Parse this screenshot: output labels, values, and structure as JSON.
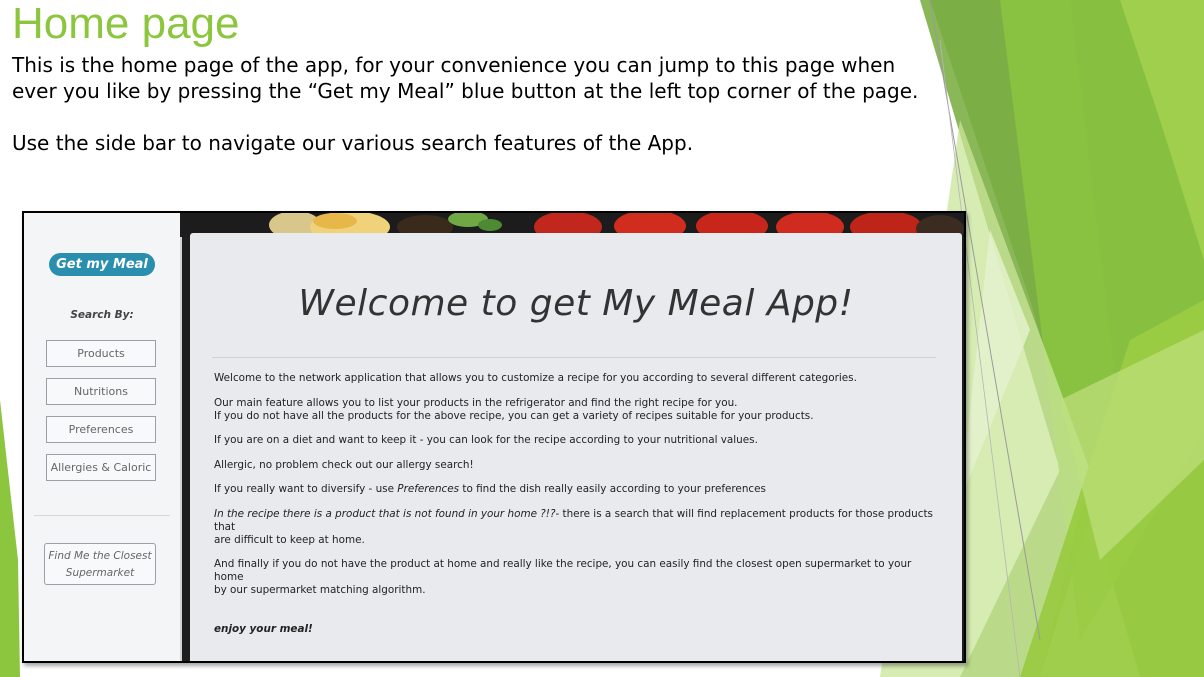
{
  "slide": {
    "title": "Home page",
    "intro_line1": "This is the home page of the app, for your convenience you can jump to this page when",
    "intro_line2": "ever you like by pressing the “Get my Meal” blue button at the left top corner of the page.",
    "intro_line3": "Use the side bar to navigate our various search features of the App.",
    "accent_color": "#8cc63f"
  },
  "app": {
    "brand_label": "Get my Meal",
    "brand_color": "#2a8fae",
    "search_by_label": "Search By:",
    "sidebar_buttons": [
      {
        "label": "Products"
      },
      {
        "label": "Nutritions"
      },
      {
        "label": "Preferences"
      },
      {
        "label": "Allergies & Caloric"
      }
    ],
    "closest_line1": "Find Me the Closest",
    "closest_line2": "Supermarket",
    "welcome_title": "Welcome to get My Meal App!",
    "paragraphs": {
      "p1": "Welcome to the network application that allows you to customize a recipe for you according to several different categories.",
      "p2a": "Our main feature allows you to list your products in the refrigerator and find the right recipe for you.",
      "p2b": "If you do not have all the products for the above recipe, you can get a variety of recipes suitable for your products.",
      "p3": "If you are on a diet and want to keep it - you can look for the recipe according to your nutritional values.",
      "p4": "Allergic, no problem check out our allergy search!",
      "p5_pre": "If you really want to diversify - use ",
      "p5_em": "Preferences",
      "p5_post": " to find the dish really easily according to your preferences",
      "p6_em": "In the recipe there is a product that is not found in your home ?!?",
      "p6_post": "- there is a search that will find replacement products for those products that",
      "p6_line2": "are difficult to keep at home.",
      "p7_line1": "And finally if you do not have the product at home and really like the recipe, you can easily find the closest open supermarket to your home",
      "p7_line2": "by our supermarket matching algorithm.",
      "enjoy": "enjoy your meal!"
    }
  }
}
